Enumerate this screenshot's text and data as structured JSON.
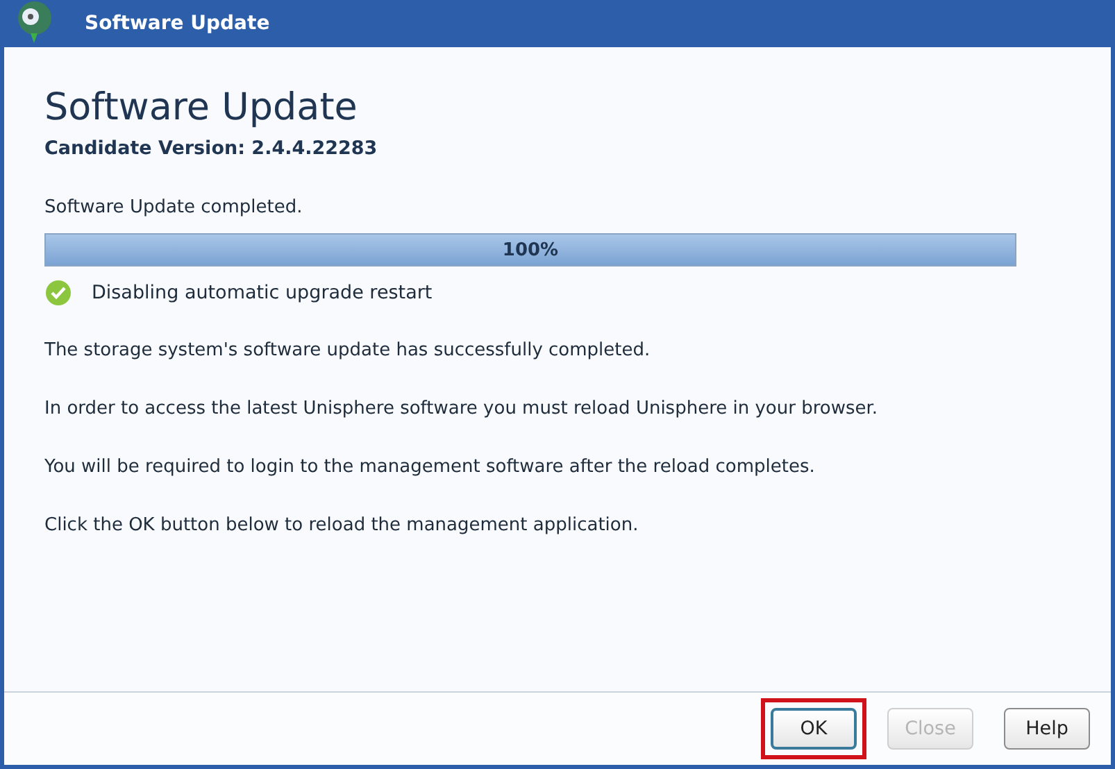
{
  "window": {
    "title": "Software Update"
  },
  "heading": "Software Update",
  "candidate_version": "Candidate Version: 2.4.4.22283",
  "status": "Software Update completed.",
  "progress": {
    "level": 1,
    "reading": "100%"
  },
  "step": {
    "label": "Disabling automatic upgrade restart",
    "done": true
  },
  "messages": [
    "The storage system's software update has successfully completed.",
    "In order to access the latest Unisphere software you must reload Unisphere in your browser.",
    "You will be required to login to the management software after the reload completes.",
    "Click the OK button below to reload the management application."
  ],
  "buttons": [
    {
      "label": "OK",
      "disabled": false,
      "highlighted": true
    },
    {
      "label": "Close",
      "disabled": true,
      "highlighted": false
    },
    {
      "label": "Help",
      "disabled": false,
      "highlighted": false
    }
  ]
}
